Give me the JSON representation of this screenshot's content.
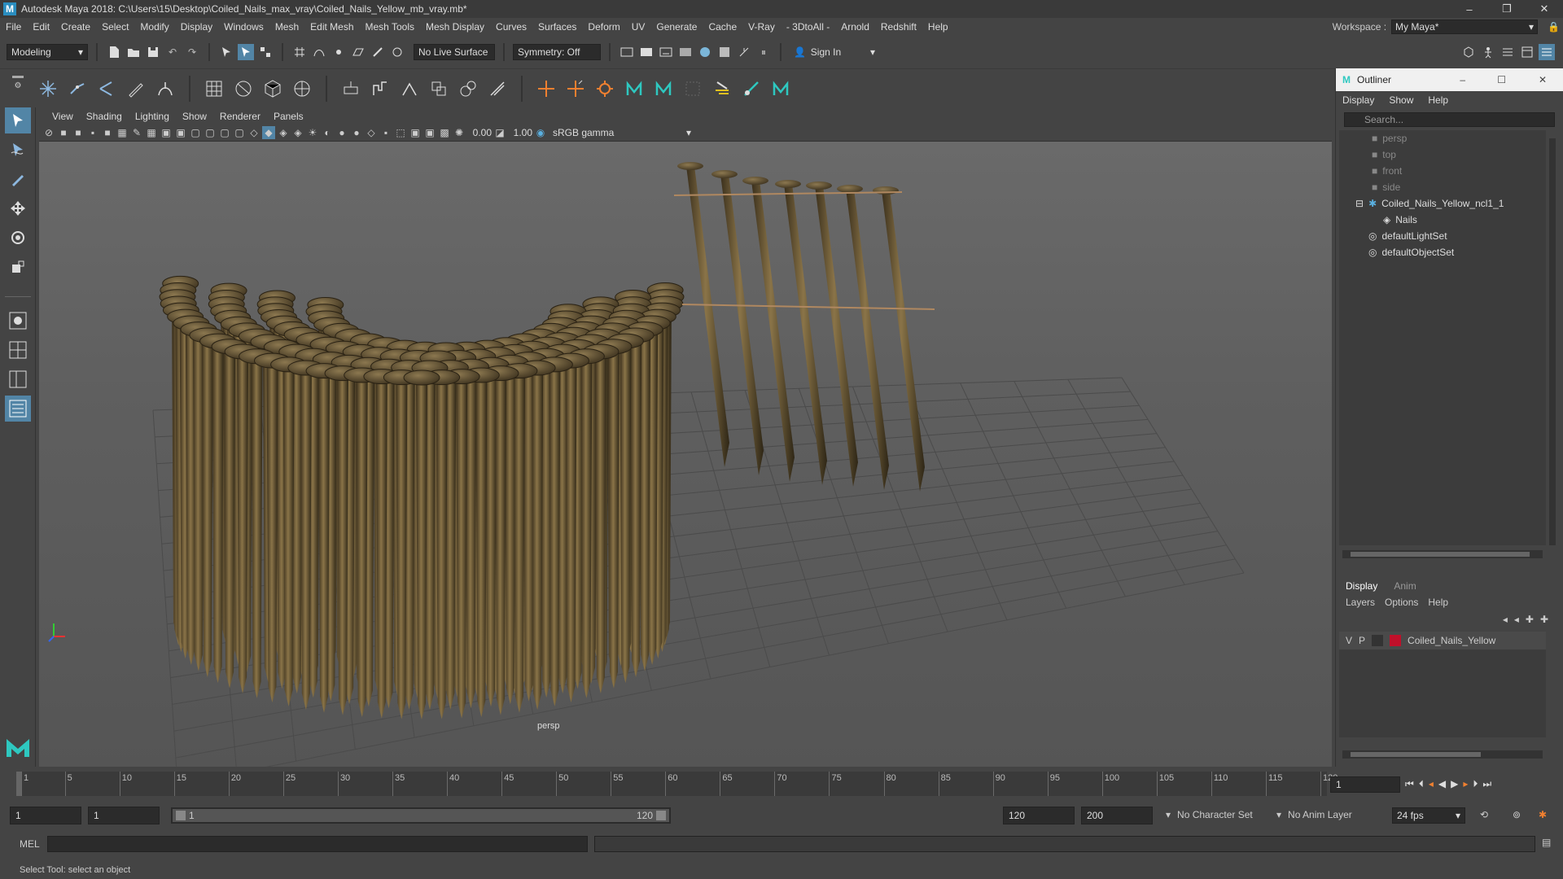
{
  "titlebar": {
    "title": "Autodesk Maya 2018: C:\\Users\\15\\Desktop\\Coiled_Nails_max_vray\\Coiled_Nails_Yellow_mb_vray.mb*",
    "minimize": "–",
    "restore": "❐",
    "close": "✕"
  },
  "menubar": {
    "items": [
      "File",
      "Edit",
      "Create",
      "Select",
      "Modify",
      "Display",
      "Windows",
      "Mesh",
      "Edit Mesh",
      "Mesh Tools",
      "Mesh Display",
      "Curves",
      "Surfaces",
      "Deform",
      "UV",
      "Generate",
      "Cache",
      "V-Ray",
      "- 3DtoAll -",
      "Arnold",
      "Redshift",
      "Help"
    ],
    "workspace_label": "Workspace :",
    "workspace_value": "My Maya*"
  },
  "statusline": {
    "mode": "Modeling",
    "live_surface": "No Live Surface",
    "symmetry": "Symmetry: Off",
    "sign_in": "Sign In"
  },
  "viewport": {
    "menu": [
      "View",
      "Shading",
      "Lighting",
      "Show",
      "Renderer",
      "Panels"
    ],
    "exposure": "0.00",
    "gamma": "1.00",
    "color_space": "sRGB gamma",
    "camera_label": "persp"
  },
  "outliner": {
    "title": "Outliner",
    "menu": [
      "Display",
      "Show",
      "Help"
    ],
    "search_placeholder": "Search...",
    "items": [
      {
        "label": "persp",
        "type": "camera",
        "dim": true
      },
      {
        "label": "top",
        "type": "camera",
        "dim": true
      },
      {
        "label": "front",
        "type": "camera",
        "dim": true
      },
      {
        "label": "side",
        "type": "camera",
        "dim": true
      },
      {
        "label": "Coiled_Nails_Yellow_ncl1_1",
        "type": "group",
        "dim": false
      },
      {
        "label": "Nails",
        "type": "mesh",
        "dim": false
      },
      {
        "label": "defaultLightSet",
        "type": "set",
        "dim": false
      },
      {
        "label": "defaultObjectSet",
        "type": "set",
        "dim": false
      }
    ]
  },
  "layers": {
    "tabs": [
      "Display",
      "Anim"
    ],
    "menu": [
      "Layers",
      "Options",
      "Help"
    ],
    "layer": {
      "v": "V",
      "p": "P",
      "name": "Coiled_Nails_Yellow",
      "color": "#c0102a"
    }
  },
  "timeslider": {
    "ticks": [
      "1",
      "5",
      "10",
      "15",
      "20",
      "25",
      "30",
      "35",
      "40",
      "45",
      "50",
      "55",
      "60",
      "65",
      "70",
      "75",
      "80",
      "85",
      "90",
      "95",
      "100",
      "105",
      "110",
      "115",
      "120"
    ],
    "current_frame": "1"
  },
  "range": {
    "start": "1",
    "playback_start": "1",
    "slider_start": "1",
    "slider_end": "120",
    "playback_end": "120",
    "end": "200",
    "character_set": "No Character Set",
    "anim_layer": "No Anim Layer",
    "fps": "24 fps"
  },
  "cmdline": {
    "label": "MEL"
  },
  "helpline": {
    "text": "Select Tool: select an object"
  },
  "colors": {
    "accent": "#5285a6",
    "maya_blue": "#2a8dbf",
    "layer_red": "#c0102a"
  }
}
